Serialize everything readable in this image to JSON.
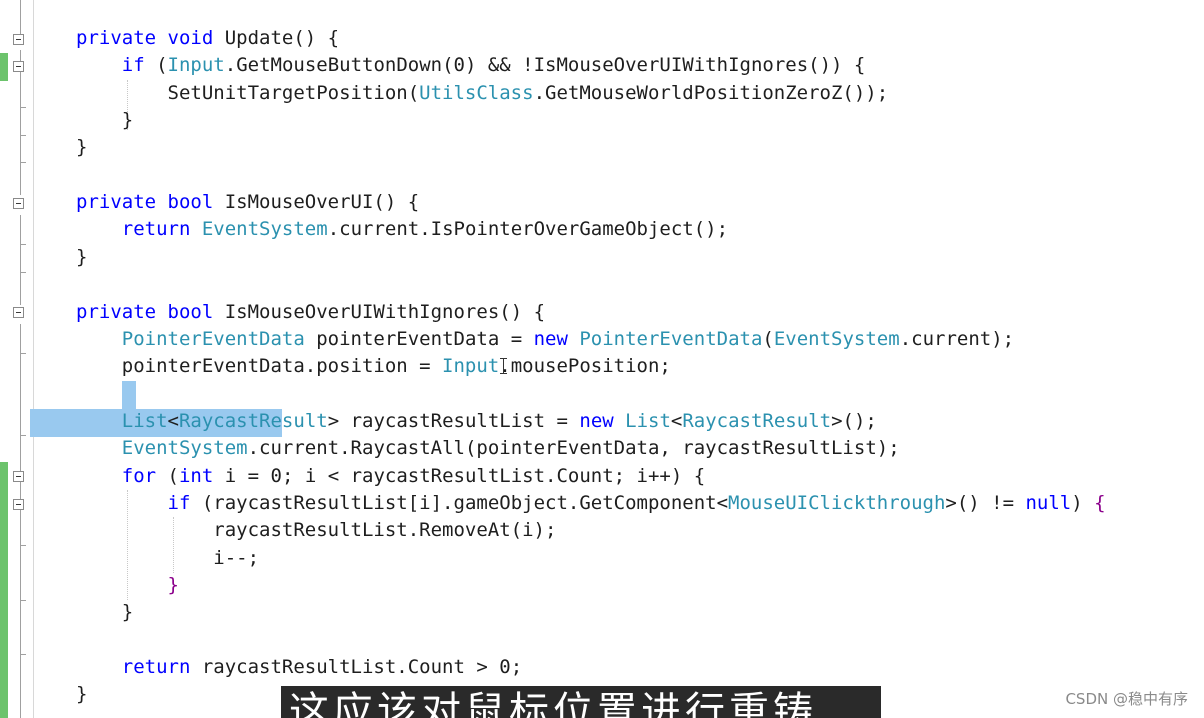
{
  "subtitle": "这应该对鼠标位置进行重铸",
  "watermark": "CSDN @稳中有序",
  "colors": {
    "keyword": "#0000ff",
    "type": "#2b91af",
    "plain": "#1e1e1e",
    "brace_control": "#8b008b",
    "selection": "#99c9ef",
    "change_bar": "#6cc36c"
  },
  "code": [
    [
      [
        "private ",
        "k"
      ],
      [
        "void ",
        "k"
      ],
      [
        "Update",
        "n"
      ],
      [
        "() {",
        "n"
      ]
    ],
    [
      [
        "    ",
        "n"
      ],
      [
        "if ",
        "k"
      ],
      [
        "(",
        "n"
      ],
      [
        "Input",
        "t"
      ],
      [
        ".GetMouseButtonDown(0) && !IsMouseOverUIWithIgnores()) {",
        "n"
      ]
    ],
    [
      [
        "        SetUnitTargetPosition(",
        "n"
      ],
      [
        "UtilsClass",
        "t"
      ],
      [
        ".GetMouseWorldPositionZeroZ());",
        "n"
      ]
    ],
    [
      [
        "    }",
        "n"
      ]
    ],
    [
      [
        "}",
        "n"
      ]
    ],
    [],
    [
      [
        "private ",
        "k"
      ],
      [
        "bool ",
        "k"
      ],
      [
        "IsMouseOverUI() {",
        "n"
      ]
    ],
    [
      [
        "    ",
        "n"
      ],
      [
        "return ",
        "k"
      ],
      [
        "EventSystem",
        "t"
      ],
      [
        ".current.IsPointerOverGameObject();",
        "n"
      ]
    ],
    [
      [
        "}",
        "n"
      ]
    ],
    [],
    [
      [
        "private ",
        "k"
      ],
      [
        "bool ",
        "k"
      ],
      [
        "IsMouseOverUIWithIgnores() {",
        "n"
      ]
    ],
    [
      [
        "    ",
        "n"
      ],
      [
        "PointerEventData",
        "t"
      ],
      [
        " pointerEventData = ",
        "n"
      ],
      [
        "new",
        "k"
      ],
      [
        " ",
        "n"
      ],
      [
        "PointerEventData",
        "t"
      ],
      [
        "(",
        "n"
      ],
      [
        "EventSystem",
        "t"
      ],
      [
        ".current);",
        "n"
      ]
    ],
    [
      [
        "    pointerEventData.position = ",
        "n"
      ],
      [
        "Input",
        "t"
      ],
      [
        ".mousePosition;",
        "n"
      ]
    ],
    [],
    [
      [
        "    ",
        "n"
      ],
      [
        "List",
        "t"
      ],
      [
        "<",
        "n"
      ],
      [
        "RaycastResult",
        "t"
      ],
      [
        "> raycastResultList = ",
        "n"
      ],
      [
        "new ",
        "k"
      ],
      [
        "List",
        "t"
      ],
      [
        "<",
        "n"
      ],
      [
        "RaycastResult",
        "t"
      ],
      [
        ">();",
        "n"
      ]
    ],
    [
      [
        "    ",
        "n"
      ],
      [
        "EventSystem",
        "t"
      ],
      [
        ".current.RaycastAll(pointerEventData, raycastResultList);",
        "n"
      ]
    ],
    [
      [
        "    ",
        "n"
      ],
      [
        "for ",
        "k"
      ],
      [
        "(",
        "n"
      ],
      [
        "int ",
        "k"
      ],
      [
        "i = 0; i < raycastResultList.Count; i++) {",
        "n"
      ]
    ],
    [
      [
        "        ",
        "n"
      ],
      [
        "if ",
        "k"
      ],
      [
        "(raycastResultList[i].gameObject.GetComponent<",
        "n"
      ],
      [
        "MouseUIClickthrough",
        "t"
      ],
      [
        ">() != ",
        "n"
      ],
      [
        "null",
        "k"
      ],
      [
        ") ",
        "n"
      ],
      [
        "{",
        "c"
      ]
    ],
    [
      [
        "            raycastResultList.RemoveAt(i);",
        "n"
      ]
    ],
    [
      [
        "            i--;",
        "n"
      ]
    ],
    [
      [
        "        ",
        "n"
      ],
      [
        "}",
        "c"
      ]
    ],
    [
      [
        "    }",
        "n"
      ]
    ],
    [],
    [
      [
        "    ",
        "n"
      ],
      [
        "return ",
        "k"
      ],
      [
        "raycastResultList.Count > 0;",
        "n"
      ]
    ],
    [
      [
        "}",
        "n"
      ]
    ]
  ]
}
